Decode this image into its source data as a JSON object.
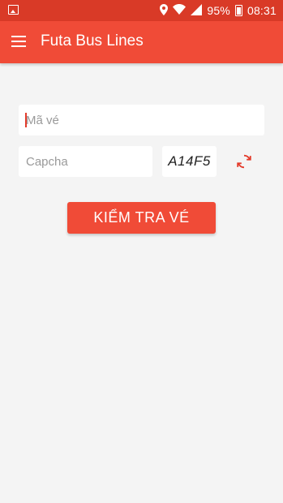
{
  "status_bar": {
    "battery": "95%",
    "time": "08:31"
  },
  "app_bar": {
    "title": "Futa Bus Lines"
  },
  "form": {
    "ticket_code": {
      "value": "",
      "placeholder": "Mã vé"
    },
    "captcha_input": {
      "value": "",
      "placeholder": "Capcha"
    },
    "captcha_code": "A14F5",
    "submit_label": "KIỂM TRA VÉ"
  },
  "colors": {
    "status_bar": "#d93a27",
    "primary": "#f04b37",
    "background": "#f4f4f4"
  }
}
